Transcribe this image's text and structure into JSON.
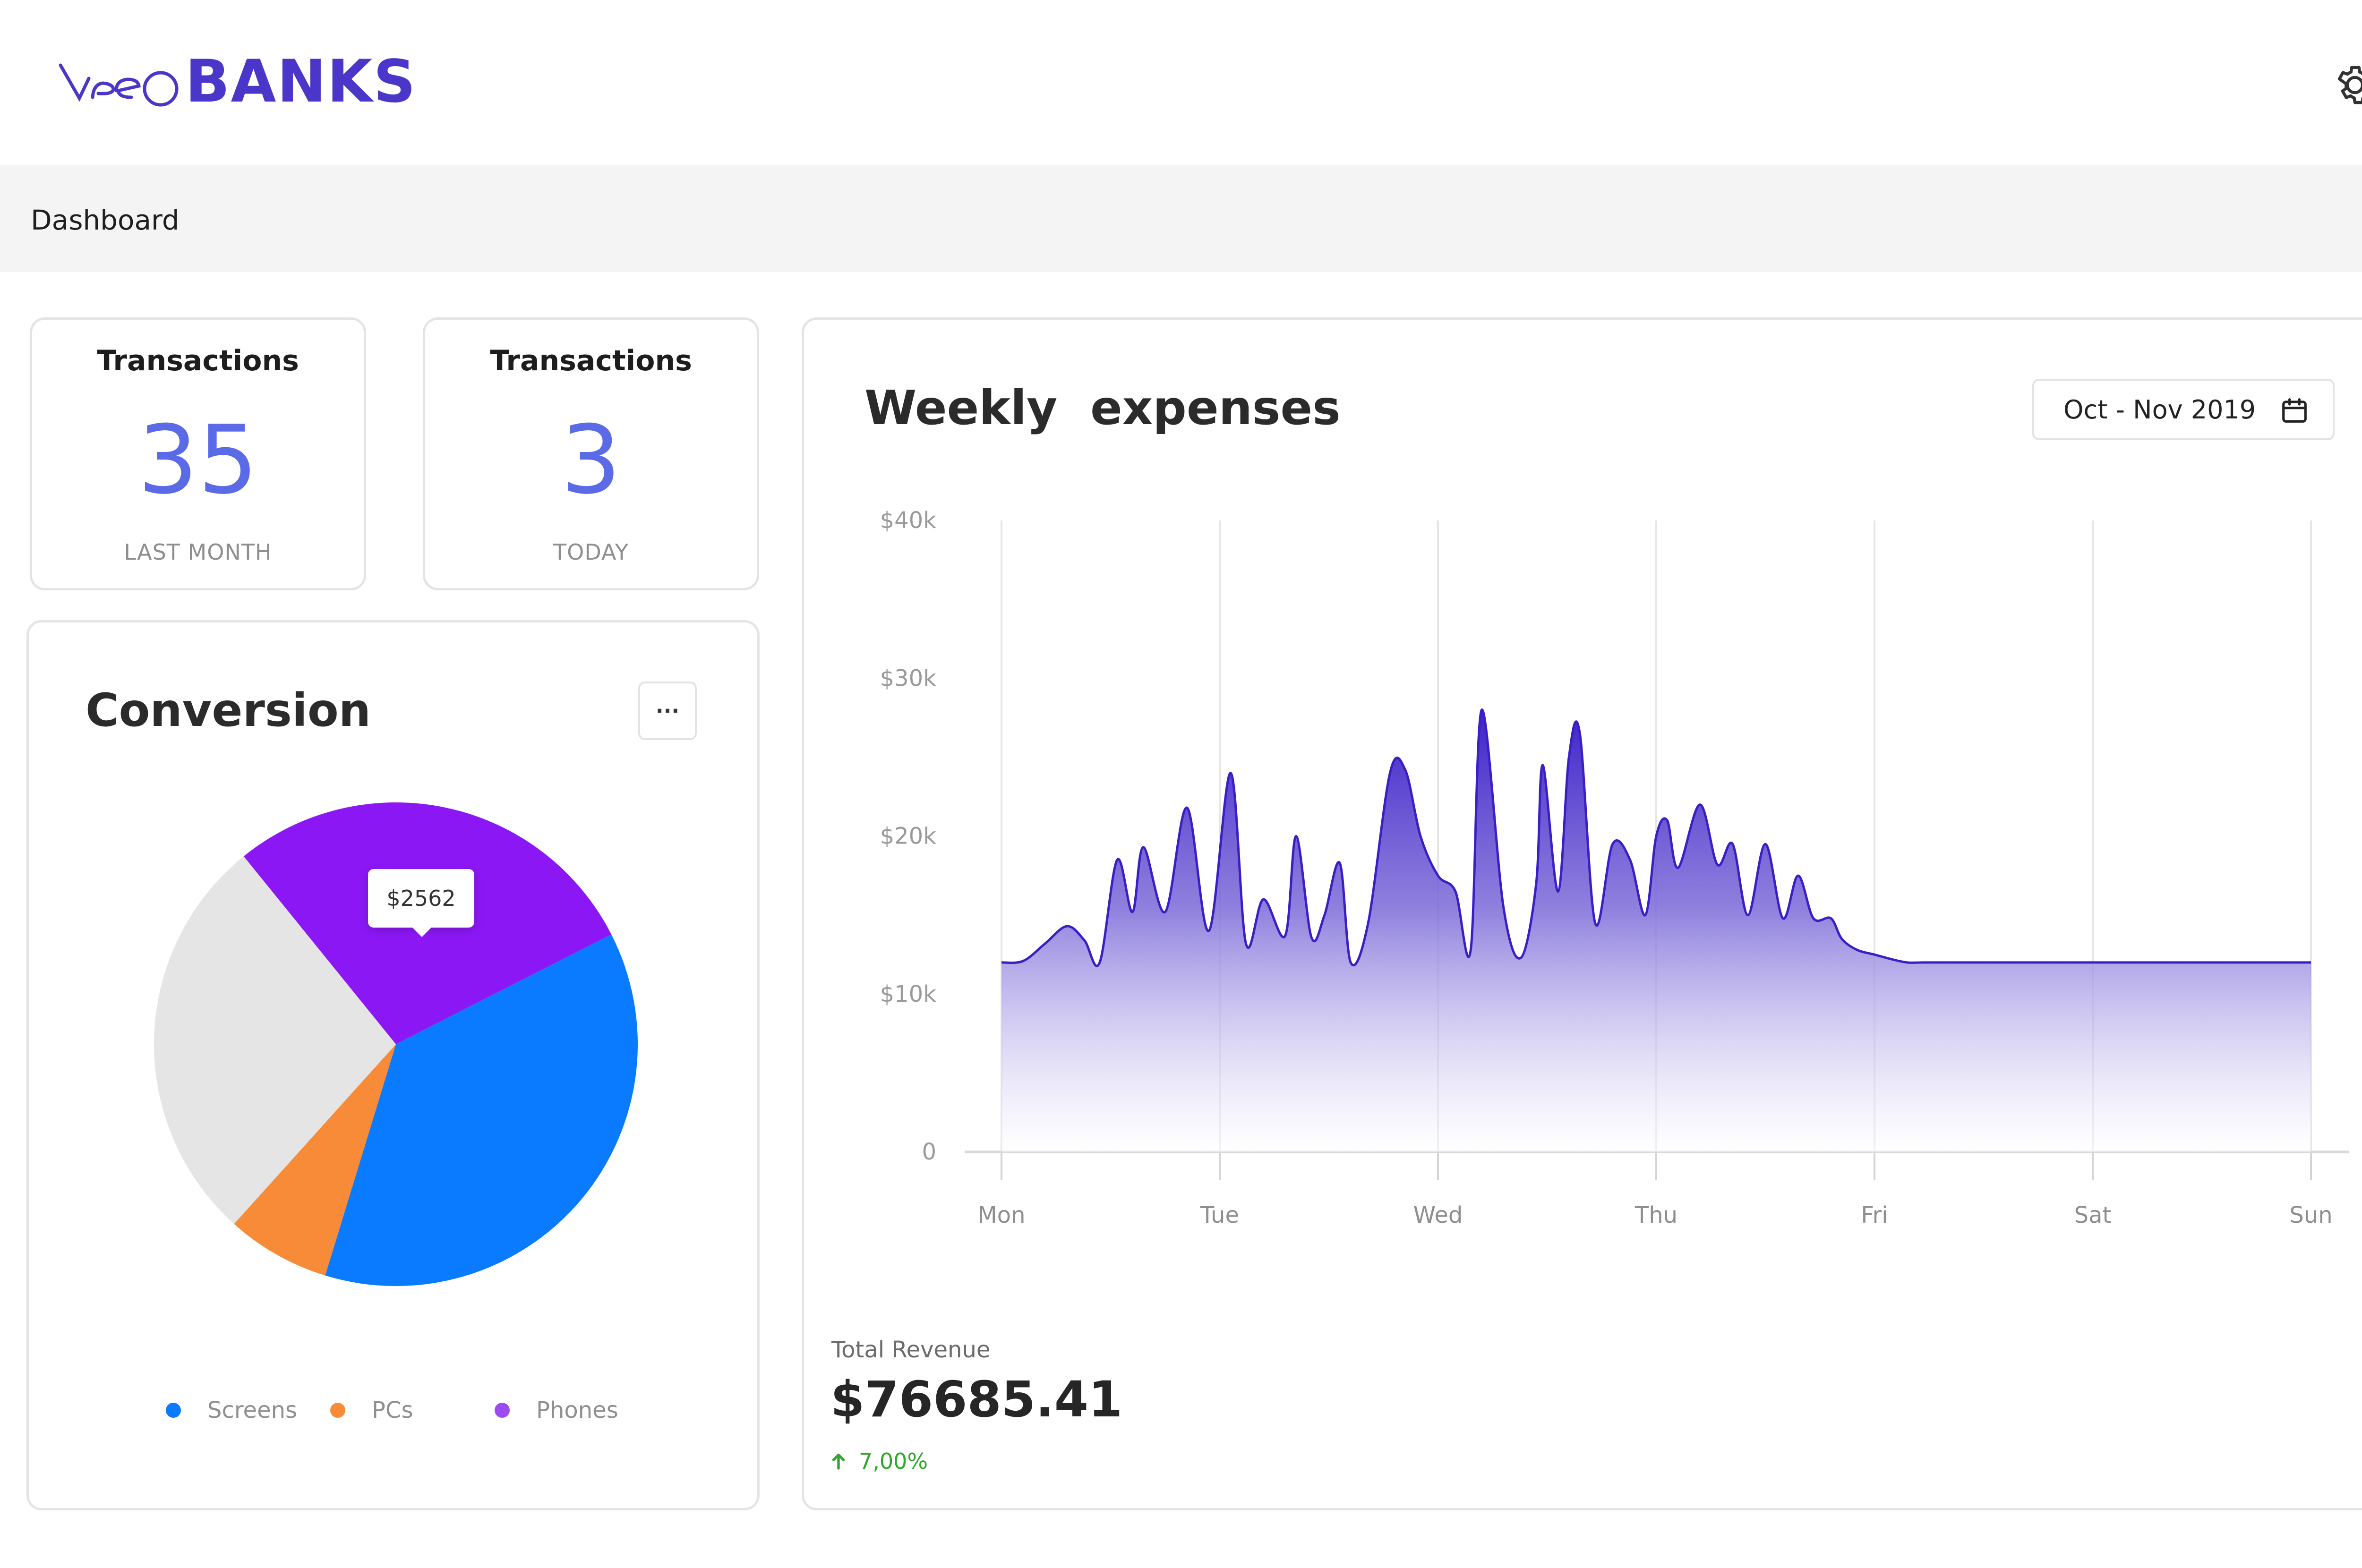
{
  "header": {
    "logo_light": "neo",
    "logo_bold": "BANKS",
    "brand_color": "#4a37c9",
    "settings_icon": "gear-icon"
  },
  "breadcrumb": {
    "label": "Dashboard"
  },
  "stats": [
    {
      "title": "Transactions",
      "value": "35",
      "subtitle": "LAST MONTH"
    },
    {
      "title": "Transactions",
      "value": "3",
      "subtitle": "TODAY"
    }
  ],
  "conversion": {
    "title": "Conversion",
    "more_label": "···",
    "tooltip": "$2562",
    "legend": [
      {
        "label": "Screens",
        "color": "#0a7bff"
      },
      {
        "label": "PCs",
        "color": "#f78b37"
      },
      {
        "label": "Phones",
        "color": "#9b4bf0"
      }
    ]
  },
  "chart_data": {
    "type": "pie",
    "slices": [
      {
        "label": "Phones",
        "color": "#8c17f5",
        "from_deg": -39,
        "to_deg": 63
      },
      {
        "label": "Screens",
        "color": "#0a7bff",
        "from_deg": 63,
        "to_deg": 197
      },
      {
        "label": "PCs",
        "color": "#f78b37",
        "from_deg": 197,
        "to_deg": 222
      },
      {
        "label": "",
        "color": "#e5e5e5",
        "from_deg": 222,
        "to_deg": 321
      }
    ]
  },
  "weekly": {
    "title": "Weekly  expenses",
    "date_range": "Oct - Nov 2019",
    "calendar_icon": "calendar-icon",
    "chart": {
      "type": "area",
      "y_ticks": [
        "$40k",
        "$30k",
        "$20k",
        "$10k",
        "0"
      ],
      "ylim": [
        0,
        40000
      ],
      "x_labels": [
        "Mon",
        "Tue",
        "Wed",
        "Thu",
        "Fri",
        "Sat",
        "Sun"
      ],
      "x": [
        0,
        0.1,
        0.2,
        0.3,
        0.38,
        0.45,
        0.53,
        0.6,
        0.65,
        0.75,
        0.85,
        0.95,
        1.05,
        1.12,
        1.2,
        1.3,
        1.35,
        1.42,
        1.48,
        1.55,
        1.6,
        1.68,
        1.78,
        1.85,
        1.92,
        2.0,
        2.08,
        2.15,
        2.2,
        2.3,
        2.38,
        2.45,
        2.48,
        2.55,
        2.6,
        2.65,
        2.72,
        2.8,
        2.88,
        2.95,
        3.0,
        3.05,
        3.1,
        3.2,
        3.28,
        3.35,
        3.42,
        3.5,
        3.58,
        3.65,
        3.72,
        3.8,
        3.85,
        3.92,
        4.0,
        4.08,
        4.15,
        4.22,
        4.3,
        4.38,
        4.45,
        4.5,
        4.55,
        4.62,
        4.7,
        4.78,
        4.85,
        4.9,
        4.95,
        5.0,
        5.05,
        5.12,
        5.2,
        5.28,
        5.35,
        5.42,
        5.5,
        5.55,
        5.6,
        5.7,
        5.8,
        5.9,
        6.0
      ],
      "values": [
        12000,
        12100,
        13200,
        14300,
        13400,
        12000,
        18500,
        15200,
        19300,
        15200,
        21800,
        14000,
        24000,
        13200,
        16000,
        13700,
        20000,
        13600,
        15000,
        18300,
        12000,
        14500,
        24000,
        24200,
        20000,
        17500,
        16500,
        12800,
        28000,
        15500,
        12300,
        17000,
        24500,
        16500,
        25000,
        26500,
        14500,
        19500,
        18500,
        15000,
        20000,
        21000,
        18000,
        22000,
        18200,
        19500,
        15000,
        19500,
        14800,
        17500,
        14800,
        14800,
        13500,
        12800,
        12500,
        12200,
        12000,
        12000,
        12000,
        12000,
        12000,
        12000,
        12000,
        12000,
        12000,
        12000,
        12000,
        12000,
        12000,
        12000,
        12000,
        12000,
        12000,
        12000,
        12000,
        12000,
        12000,
        12000,
        12000,
        12000,
        12000,
        12000,
        12000
      ]
    }
  },
  "revenue": {
    "label": "Total Revenue",
    "value": "$76685.41",
    "change": "7,00%",
    "change_color": "#30a82b"
  }
}
